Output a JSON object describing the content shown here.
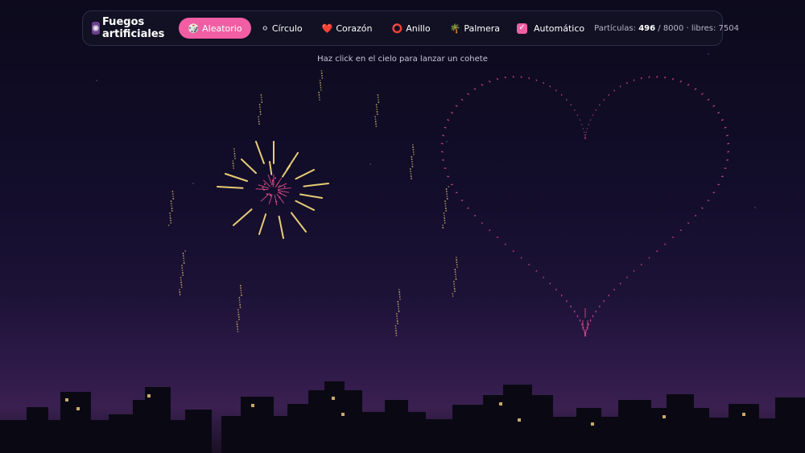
{
  "app": {
    "title": "Fuegos artificiales",
    "icon": "fireworks-icon"
  },
  "modes": [
    {
      "id": "aleatorio",
      "icon": "🎲",
      "icon_name": "dice-icon",
      "label": "Aleatorio",
      "active": true
    },
    {
      "id": "circulo",
      "icon": "⚪",
      "icon_name": "circle-icon",
      "label": "Círculo",
      "active": false
    },
    {
      "id": "corazon",
      "icon": "❤️",
      "icon_name": "heart-icon",
      "label": "Corazón",
      "active": false
    },
    {
      "id": "anillo",
      "icon": "⭕",
      "icon_name": "ring-icon",
      "label": "Anillo",
      "active": false
    },
    {
      "id": "palmera",
      "icon": "🌴",
      "icon_name": "palm-icon",
      "label": "Palmera",
      "active": false
    }
  ],
  "auto": {
    "label": "Automático",
    "checked": true
  },
  "stats": {
    "particles_label": "Partículas:",
    "particles": "496",
    "max": "8000",
    "free_label": "libres:",
    "free": "7504"
  },
  "hint": "Haz click en el cielo para lanzar un cohete",
  "colors": {
    "accent": "#f25ea3",
    "sky_top": "#0c0a1c",
    "sky_horizon": "#3a2050",
    "building": "#0a0913",
    "window": "#c9a86a",
    "spark_gold": "#f3d77a",
    "spark_pink": "#e0508f"
  }
}
